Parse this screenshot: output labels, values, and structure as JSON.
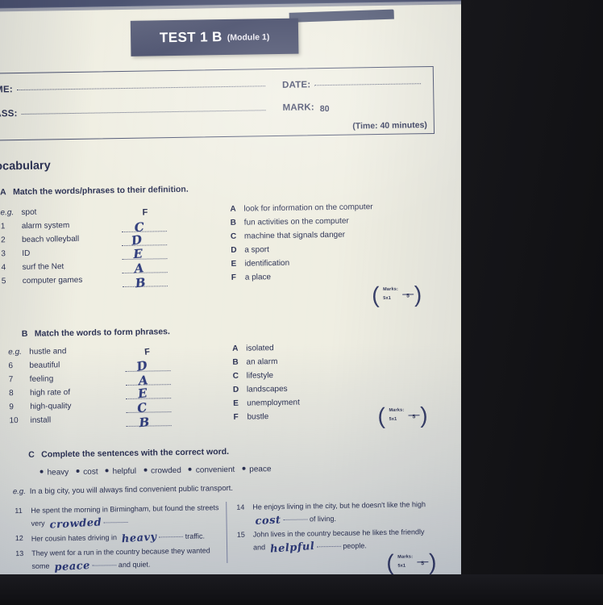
{
  "header": {
    "test_title": "TEST 1 B",
    "module": "(Module 1)"
  },
  "id_box": {
    "name_label": "NAME:",
    "class_label": "CLASS:",
    "date_label": "DATE:",
    "mark_label": "MARK:",
    "mark_total": "80",
    "time_note": "(Time: 40 minutes)"
  },
  "vocabulary_heading": "Vocabulary",
  "task_a": {
    "letter": "A",
    "instruction": "Match the words/phrases to their definition.",
    "items": [
      {
        "num": "e.g.",
        "text": "spot",
        "answer": "F",
        "is_example": true
      },
      {
        "num": "1",
        "text": "alarm system",
        "answer": "C",
        "is_example": false
      },
      {
        "num": "2",
        "text": "beach volleyball",
        "answer": "D",
        "is_example": false
      },
      {
        "num": "3",
        "text": "ID",
        "answer": "E",
        "is_example": false
      },
      {
        "num": "4",
        "text": "surf the Net",
        "answer": "A",
        "is_example": false
      },
      {
        "num": "5",
        "text": "computer games",
        "answer": "B",
        "is_example": false
      }
    ],
    "definitions": [
      {
        "letter": "A",
        "text": "look for information on the computer"
      },
      {
        "letter": "B",
        "text": "fun activities on the computer"
      },
      {
        "letter": "C",
        "text": "machine that signals danger"
      },
      {
        "letter": "D",
        "text": "a sport"
      },
      {
        "letter": "E",
        "text": "identification"
      },
      {
        "letter": "F",
        "text": "a place"
      }
    ],
    "marks": {
      "line1": "Marks:",
      "line2": "5x1",
      "value": "5"
    }
  },
  "task_b": {
    "letter": "B",
    "instruction": "Match the words to form phrases.",
    "items": [
      {
        "num": "e.g.",
        "text": "hustle and",
        "answer": "F",
        "is_example": true
      },
      {
        "num": "6",
        "text": "beautiful",
        "answer": "D",
        "is_example": false
      },
      {
        "num": "7",
        "text": "feeling",
        "answer": "A",
        "is_example": false
      },
      {
        "num": "8",
        "text": "high rate of",
        "answer": "E",
        "is_example": false
      },
      {
        "num": "9",
        "text": "high-quality",
        "answer": "C",
        "is_example": false
      },
      {
        "num": "10",
        "text": "install",
        "answer": "B",
        "is_example": false
      }
    ],
    "definitions": [
      {
        "letter": "A",
        "text": "isolated"
      },
      {
        "letter": "B",
        "text": "an alarm"
      },
      {
        "letter": "C",
        "text": "lifestyle"
      },
      {
        "letter": "D",
        "text": "landscapes"
      },
      {
        "letter": "E",
        "text": "unemployment"
      },
      {
        "letter": "F",
        "text": "bustle"
      }
    ],
    "marks": {
      "line1": "Marks:",
      "line2": "5x1",
      "value": "5"
    }
  },
  "task_c": {
    "letter": "C",
    "instruction": "Complete the sentences with the correct word.",
    "word_bank": [
      "heavy",
      "cost",
      "helpful",
      "crowded",
      "convenient",
      "peace"
    ],
    "example": {
      "tag": "e.g.",
      "text": "In a big city, you will always find convenient public transport."
    },
    "questions_left": [
      {
        "num": "11",
        "before": "He spent the morning in Birmingham, but found the streets very",
        "answer": "crowded",
        "after": ""
      },
      {
        "num": "12",
        "before": "Her cousin hates driving in",
        "answer": "heavy",
        "after": "traffic."
      },
      {
        "num": "13",
        "before": "They went for a run in the country because they wanted some",
        "answer": "peace",
        "after": "and quiet."
      }
    ],
    "questions_right": [
      {
        "num": "14",
        "before": "He enjoys living in the city, but he doesn't like the high",
        "answer": "cost",
        "after": "of living."
      },
      {
        "num": "15",
        "before": "John lives in the country because he likes the friendly and",
        "answer": "helpful",
        "after": "people."
      }
    ],
    "marks": {
      "line1": "Marks:",
      "line2": "5x1",
      "value": "5"
    }
  },
  "colors": {
    "ink": "#2e3456",
    "banner": "#3e4463",
    "handwriting": "#33407e",
    "paper": "#efeee2"
  }
}
